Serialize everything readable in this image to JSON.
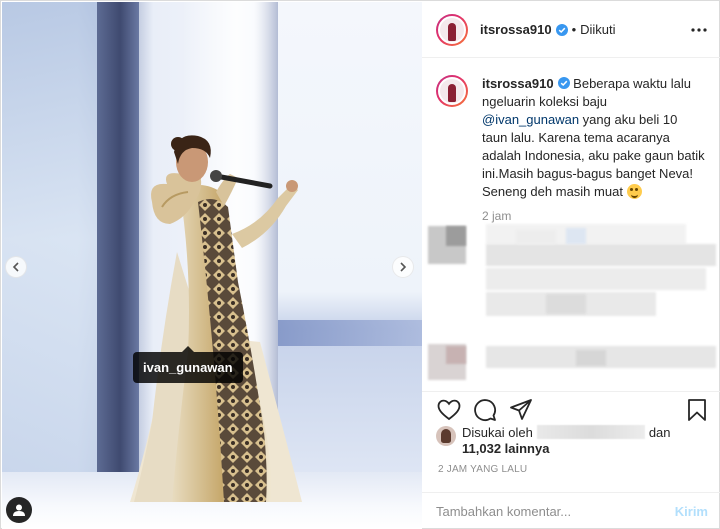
{
  "post": {
    "image_tag": "ivan_gunawan",
    "photo_alt": "Singer performing on stage in a gold batik gown"
  },
  "header": {
    "username": "itsrossa910",
    "separator": "•",
    "follow_status": "Diikuti",
    "more_icon": "more-horizontal-icon"
  },
  "caption": {
    "username": "itsrossa910",
    "text_before_mention": " Beberapa waktu lalu ngeluarin koleksi baju ",
    "mention": "@ivan_gunawan",
    "text_after_mention": " yang aku beli 10 taun lalu. Karena tema acaranya adalah Indonesia, aku pake gaun batik ini.Masih bagus-bagus banget Neva! Seneng deh masih muat ",
    "emoji": "grinning-face-emoji",
    "time": "2 jam"
  },
  "likes": {
    "prefix": "Disukai oleh",
    "suffix": "dan",
    "count": "11,032 lainnya"
  },
  "posted_time": "2 JAM YANG LALU",
  "comment": {
    "placeholder": "Tambahkan komentar...",
    "submit_label": "Kirim"
  },
  "colors": {
    "mention": "#00376b",
    "muted": "#8e8e8e",
    "submit_disabled": "#b2dffc",
    "verified": "#3897f0"
  }
}
